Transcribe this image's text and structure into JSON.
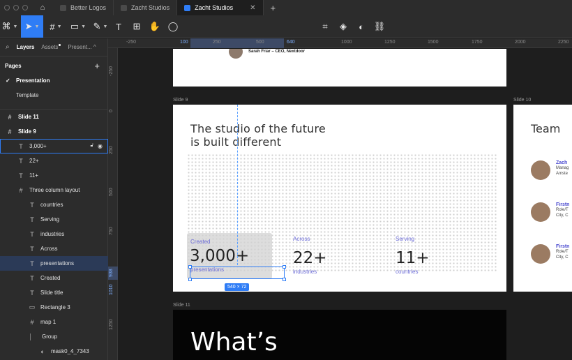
{
  "tabs": {
    "items": [
      {
        "label": "Better Logos"
      },
      {
        "label": "Zacht Studios"
      },
      {
        "label": "Zacht Studios"
      }
    ],
    "close_glyph": "✕",
    "new_glyph": "+"
  },
  "icons": {
    "home": "⌂",
    "figma_menu": "⌘",
    "move": "➤",
    "frame": "#",
    "rect": "▭",
    "pen": "✎",
    "text": "T",
    "resources": "⊞",
    "hand": "✋",
    "comment": "◯",
    "crop": "⌗",
    "component": "◈",
    "mask": "◐",
    "link": "⛓",
    "search": "⌕"
  },
  "left_panel": {
    "tabs": {
      "layers": "Layers",
      "assets": "Assets",
      "present": "Present..."
    },
    "pages_heading": "Pages",
    "pages": [
      {
        "label": "Presentation",
        "current": true
      },
      {
        "label": "Template",
        "current": false
      }
    ],
    "layers": [
      {
        "label": "Slide 11",
        "icon": "#",
        "indent": 0,
        "bold": true
      },
      {
        "label": "Slide 9",
        "icon": "#",
        "indent": 0,
        "bold": true
      },
      {
        "label": "3,000+",
        "icon": "T",
        "indent": 1,
        "state": "hover"
      },
      {
        "label": "22+",
        "icon": "T",
        "indent": 1
      },
      {
        "label": "11+",
        "icon": "T",
        "indent": 1
      },
      {
        "label": "Three column layout",
        "icon": "#",
        "indent": 1
      },
      {
        "label": "countries",
        "icon": "T",
        "indent": 2
      },
      {
        "label": "Serving",
        "icon": "T",
        "indent": 2
      },
      {
        "label": "industries",
        "icon": "T",
        "indent": 2
      },
      {
        "label": "Across",
        "icon": "T",
        "indent": 2
      },
      {
        "label": "presentations",
        "icon": "T",
        "indent": 2,
        "state": "selected"
      },
      {
        "label": "Created",
        "icon": "T",
        "indent": 2
      },
      {
        "label": "Slide title",
        "icon": "T",
        "indent": 2
      },
      {
        "label": "Rectangle 3",
        "icon": "▭",
        "indent": 2
      },
      {
        "label": "map 1",
        "icon": "#",
        "indent": 2
      },
      {
        "label": "Group",
        "icon": "",
        "indent": 3
      },
      {
        "label": "mask0_4_7343",
        "icon": "◐",
        "indent": 3
      }
    ]
  },
  "rulers": {
    "top": [
      "-250",
      "100",
      "250",
      "500",
      "640",
      "1000",
      "1250",
      "1500",
      "1750",
      "2000",
      "2250"
    ],
    "left": [
      "-250",
      "0",
      "250",
      "500",
      "750",
      "938",
      "1010",
      "1250"
    ]
  },
  "canvas": {
    "prev_slide": {
      "quote_author": "Sarah Friar – CEO, Nextdoor"
    },
    "slide9": {
      "label": "Slide 9",
      "title_line1": "The studio of the future",
      "title_line2": "is built different",
      "stats": [
        {
          "label": "Created",
          "value": "3,000+",
          "sub": "presentations"
        },
        {
          "label": "Across",
          "value": "22+",
          "sub": "industries"
        },
        {
          "label": "Serving",
          "value": "11+",
          "sub": "countries"
        }
      ],
      "size_badge": "540 × 72"
    },
    "slide10": {
      "label": "Slide 10",
      "title": "Team",
      "members": [
        {
          "name": "Zach",
          "role_line1": "Manag",
          "role_line2": "Amste"
        },
        {
          "name": "Firstn",
          "role_line1": "Role/T",
          "role_line2": "City, C"
        },
        {
          "name": "Firstn",
          "role_line1": "Role/T",
          "role_line2": "City, C"
        }
      ]
    },
    "slide11": {
      "label": "Slide 11",
      "heading": "What’s"
    }
  }
}
